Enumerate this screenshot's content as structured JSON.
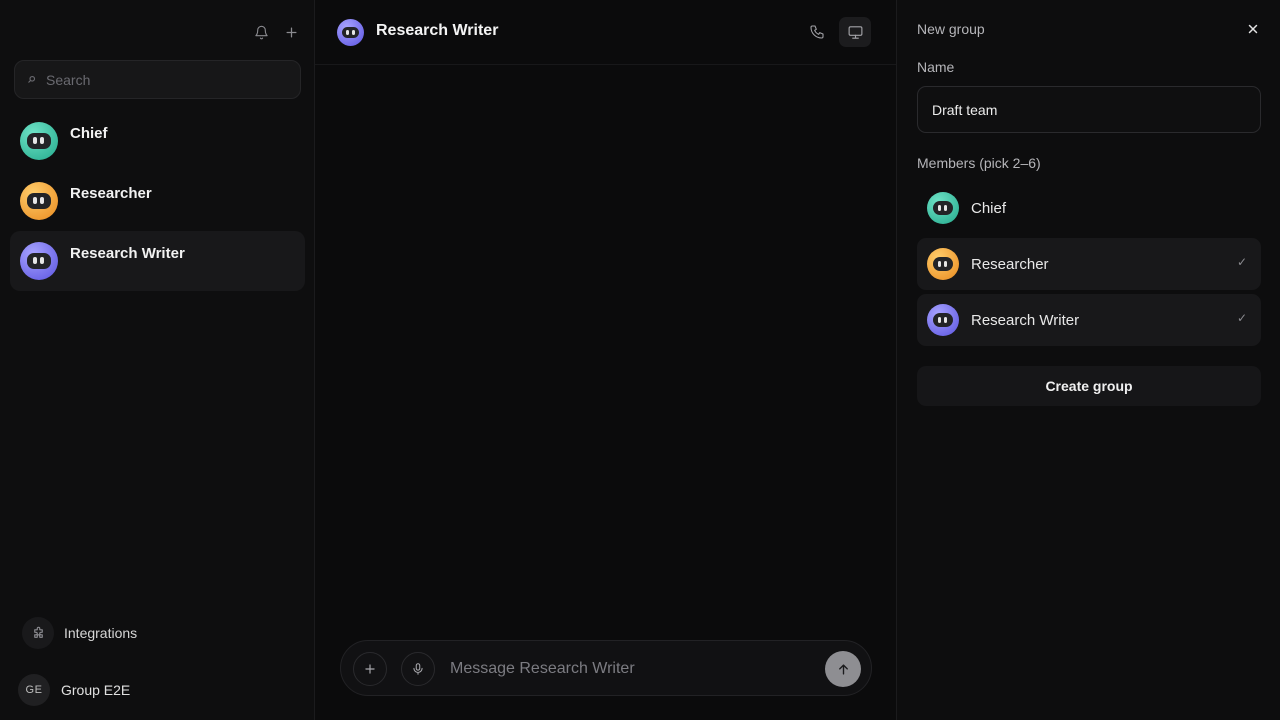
{
  "sidebar": {
    "search": {
      "placeholder": "Search",
      "value": ""
    },
    "agents": [
      {
        "name": "Chief",
        "avatar_color": "teal",
        "active": false
      },
      {
        "name": "Researcher",
        "avatar_color": "orange",
        "active": false
      },
      {
        "name": "Research Writer",
        "avatar_color": "purple",
        "active": true
      }
    ],
    "integrations_label": "Integrations",
    "user": {
      "initials": "GE",
      "name": "Group E2E"
    }
  },
  "chat": {
    "title": "Research Writer",
    "composer": {
      "placeholder": "Message Research Writer",
      "value": ""
    }
  },
  "new_group": {
    "title": "New group",
    "name_label": "Name",
    "name_value": "Draft team",
    "members_label": "Members (pick 2–6)",
    "members": [
      {
        "name": "Chief",
        "selected": false
      },
      {
        "name": "Researcher",
        "selected": true
      },
      {
        "name": "Research Writer",
        "selected": true
      }
    ],
    "check_mark": "✓",
    "create_label": "Create group"
  },
  "colors": {
    "background": "#0b0b0c",
    "sidebar": "#0e0e0f",
    "active_item": "#18181a",
    "teal_avatar": "#23a98c",
    "orange_avatar": "#e98a1f",
    "purple_avatar": "#5b54e0"
  },
  "icons": [
    "bell-icon",
    "plus-icon",
    "search-icon",
    "puzzle-icon",
    "phone-icon",
    "monitor-icon",
    "microphone-icon",
    "arrow-up-icon",
    "close-icon",
    "check-icon"
  ]
}
